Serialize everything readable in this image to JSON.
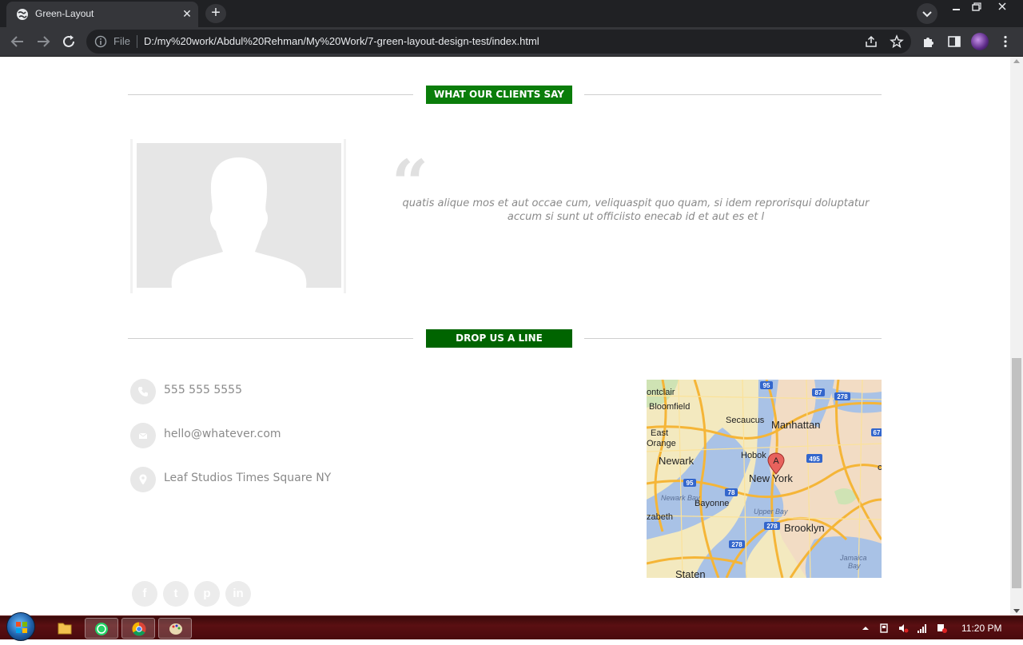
{
  "browser": {
    "tab_title": "Green-Layout",
    "scheme_label": "File",
    "url": "D:/my%20work/Abdul%20Rehman/My%20Work/7-green-layout-design-test/index.html"
  },
  "sections": {
    "testimonials_heading": "WHAT OUR CLIENTS SAY",
    "contact_heading": "DROP US A LINE",
    "heading_colors": [
      "#0a7d0a",
      "#006400"
    ]
  },
  "testimonial": {
    "quote": "quatis alique mos et aut occae cum, veliquaspit quo quam, si idem reprorisqui doluptatur accum si sunt ut officiisto enecab id et aut es et l"
  },
  "contact": {
    "phone": "555 555 5555",
    "email": "hello@whatever.com",
    "address": "Leaf Studios Times Square NY"
  },
  "map": {
    "labels": {
      "montclair": "ontclair",
      "bloomfield": "Bloomfield",
      "secaucus": "Secaucus",
      "manhattan": "Manhattan",
      "east_orange": "East\nOrange",
      "east": "East",
      "orange": "Orange",
      "newark": "Newark",
      "hoboken": "Hobok",
      "new_york": "New York",
      "newark_bay": "Newark Bay",
      "bayonne": "Bayonne",
      "elizabeth": "zabeth",
      "upper_bay": "Upper Bay",
      "brooklyn": "Brooklyn",
      "staten": "Staten",
      "jamaica_bay": "Jamaica",
      "bay": "Bay",
      "marker": "A"
    },
    "shields": [
      "95",
      "87",
      "278",
      "67",
      "495",
      "95",
      "78",
      "278",
      "278",
      "C"
    ]
  },
  "social": {
    "facebook": "f",
    "twitter": "t",
    "pinterest": "p",
    "linkedin": "in"
  },
  "taskbar": {
    "clock": "11:20 PM"
  }
}
